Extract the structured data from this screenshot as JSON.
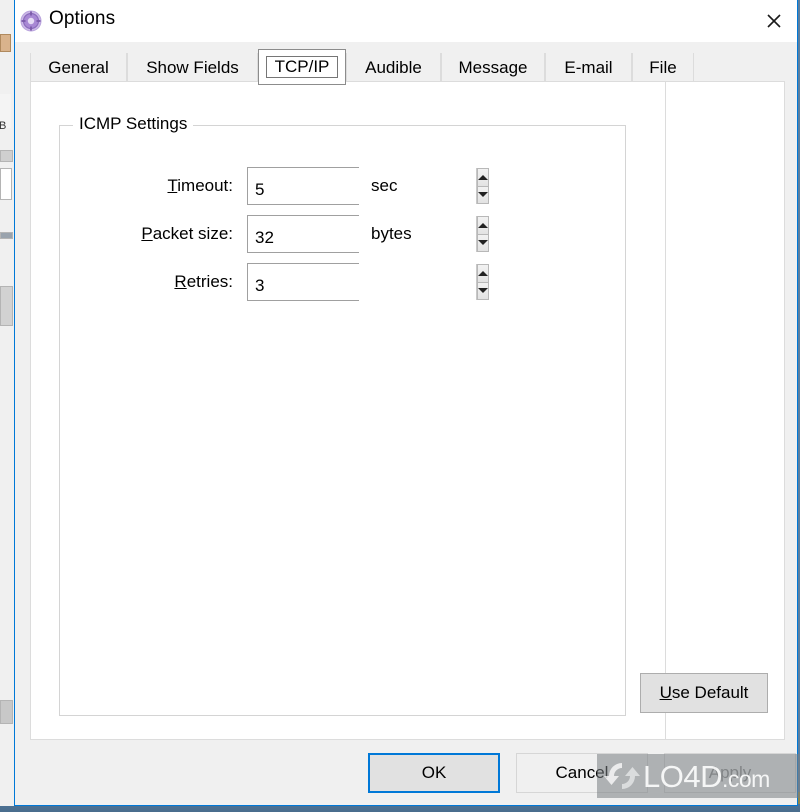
{
  "window": {
    "title": "Options",
    "icon": "target-icon",
    "close_label": "×",
    "border_color": "#0078d7",
    "titlebar_bg": "#ffffff",
    "body_bg": "#f0f0f0"
  },
  "tabs": [
    {
      "label": "General",
      "selected": false
    },
    {
      "label": "Show Fields",
      "selected": false
    },
    {
      "label": "TCP/IP",
      "selected": true
    },
    {
      "label": "Audible",
      "selected": false
    },
    {
      "label": "Message",
      "selected": false
    },
    {
      "label": "E-mail",
      "selected": false
    },
    {
      "label": "File",
      "selected": false
    }
  ],
  "tcpip": {
    "group_title": "ICMP Settings",
    "fields": [
      {
        "label_prefix": "",
        "accel": "T",
        "label_suffix": "imeout:",
        "value": "5",
        "unit": "sec"
      },
      {
        "label_prefix": "",
        "accel": "P",
        "label_suffix": "acket size:",
        "value": "32",
        "unit": "bytes"
      },
      {
        "label_prefix": "",
        "accel": "R",
        "label_suffix": "etries:",
        "value": "3",
        "unit": ""
      }
    ],
    "use_default": {
      "accel": "U",
      "label_suffix": "se Default"
    }
  },
  "footer": {
    "ok_label": "OK",
    "cancel_label": "Cancel",
    "apply_label": "Apply",
    "apply_disabled": true,
    "default_button": "OK"
  },
  "watermark": {
    "brand": "LO4D",
    "tld": ".com",
    "icon": "refresh-arrows-icon"
  },
  "background": {
    "partial_text": "B"
  }
}
